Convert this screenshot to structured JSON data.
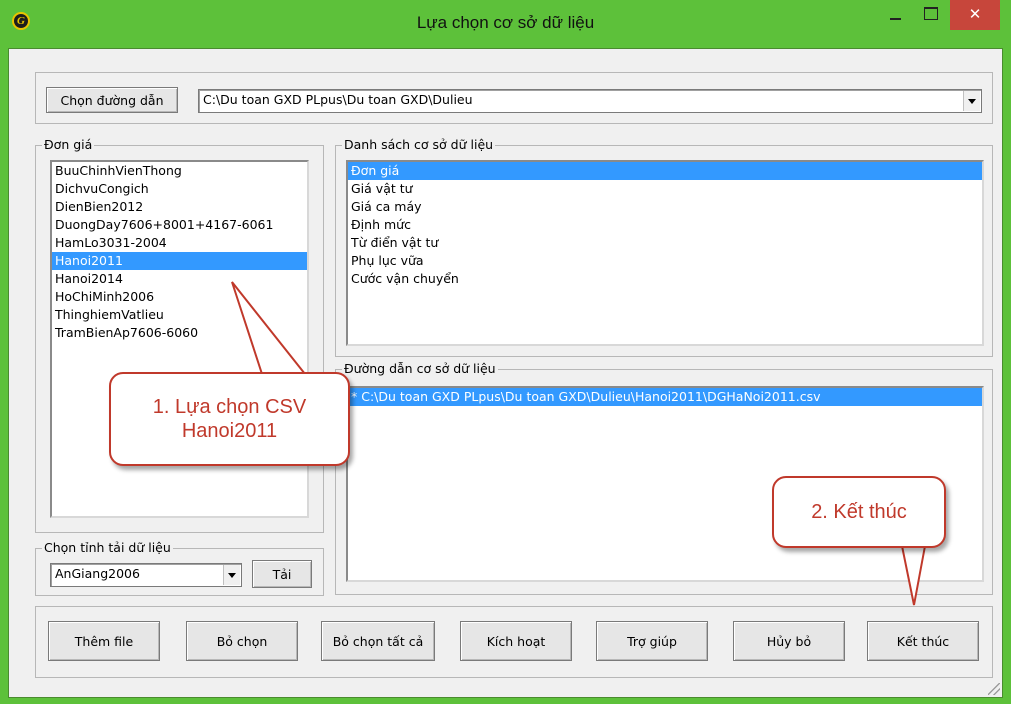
{
  "window": {
    "title": "Lựa chọn cơ sở dữ liệu",
    "app_icon": "G",
    "close_glyph": "✕"
  },
  "path_bar": {
    "choose_button": "Chọn đường dẫn",
    "path_value": "C:\\Du toan GXD PLpus\\Du toan GXD\\Dulieu"
  },
  "don_gia": {
    "label": "Đơn giá",
    "items": [
      "BuuChinhVienThong",
      "DichvuCongich",
      "DienBien2012",
      "DuongDay7606+8001+4167-6061",
      "HamLo3031-2004",
      "Hanoi2011",
      "Hanoi2014",
      "HoChiMinh2006",
      "ThinghiemVatlieu",
      "TramBienAp7606-6060"
    ],
    "selected_index": 5
  },
  "chon_tinh": {
    "label": "Chọn tỉnh tải dữ liệu",
    "selected_value": "AnGiang2006",
    "load_button": "Tải"
  },
  "danh_sach": {
    "label": "Danh sách cơ sở dữ liệu",
    "items": [
      "Đơn giá",
      "Giá vật tư",
      "Giá ca máy",
      "Định mức",
      "Từ điển vật tư",
      "Phụ lục vữa",
      "Cước vận chuyển"
    ],
    "selected_index": 0
  },
  "duong_dan": {
    "label": "Đường dẫn cơ sở dữ liệu",
    "items": [
      "* C:\\Du toan GXD PLpus\\Du toan GXD\\Dulieu\\Hanoi2011\\DGHaNoi2011.csv"
    ],
    "selected_index": 0
  },
  "buttons": {
    "add_file": "Thêm file",
    "deselect": "Bỏ chọn",
    "deselect_all": "Bỏ chọn tất cả",
    "activate": "Kích hoạt",
    "help": "Trợ giúp",
    "cancel": "Hủy bỏ",
    "finish": "Kết thúc"
  },
  "callouts": {
    "step1_line1": "1. Lựa chọn CSV",
    "step1_line2": "Hanoi2011",
    "step2": "2. Kết thúc"
  },
  "colors": {
    "frame_green": "#5dc13a",
    "selection_blue": "#3399ff",
    "close_red": "#c7463b",
    "callout_red": "#c0392b"
  }
}
